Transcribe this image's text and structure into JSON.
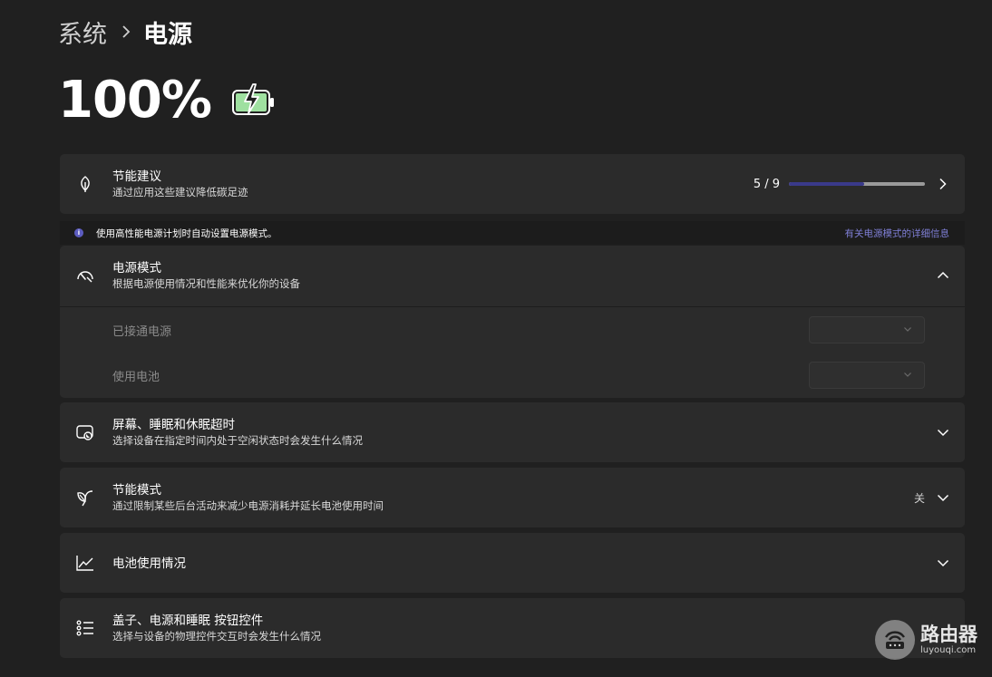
{
  "breadcrumb": {
    "parent": "系统",
    "current": "电源"
  },
  "battery": {
    "percent": "100%",
    "level": 1.0,
    "charging": true,
    "fill_color": "#9fe0a0"
  },
  "energy_recommendations": {
    "title": "节能建议",
    "subtitle": "通过应用这些建议降低碳足迹",
    "progress_text": "5 / 9",
    "progress_done": 5,
    "progress_total": 9,
    "icon": "leaf-icon"
  },
  "info_bar": {
    "text": "使用高性能电源计划时自动设置电源模式。",
    "link": "有关电源模式的详细信息"
  },
  "power_mode": {
    "title": "电源模式",
    "subtitle": "根据电源使用情况和性能来优化你的设备",
    "icon": "gauge-icon",
    "expanded": true,
    "plugged_in_label": "已接通电源",
    "on_battery_label": "使用电池",
    "plugged_in_value": "",
    "on_battery_value": ""
  },
  "screen_sleep": {
    "title": "屏幕、睡眠和休眠超时",
    "subtitle": "选择设备在指定时间内处于空闲状态时会发生什么情况",
    "icon": "screen-sleep-icon"
  },
  "energy_saver": {
    "title": "节能模式",
    "subtitle": "通过限制某些后台活动来减少电源消耗并延长电池使用时间",
    "value": "关",
    "icon": "energy-saver-icon"
  },
  "battery_usage": {
    "title": "电池使用情况",
    "icon": "chart-line-icon"
  },
  "lid_buttons": {
    "title": "盖子、电源和睡眠 按钮控件",
    "subtitle": "选择与设备的物理控件交互时会发生什么情况",
    "icon": "list-settings-icon"
  },
  "watermark": {
    "title": "路由器",
    "sub": "luyouqi.com"
  },
  "colors": {
    "background": "#202020",
    "card": "#2b2b2b",
    "accent": "#3a3a8a",
    "link": "#7f7fd6"
  }
}
